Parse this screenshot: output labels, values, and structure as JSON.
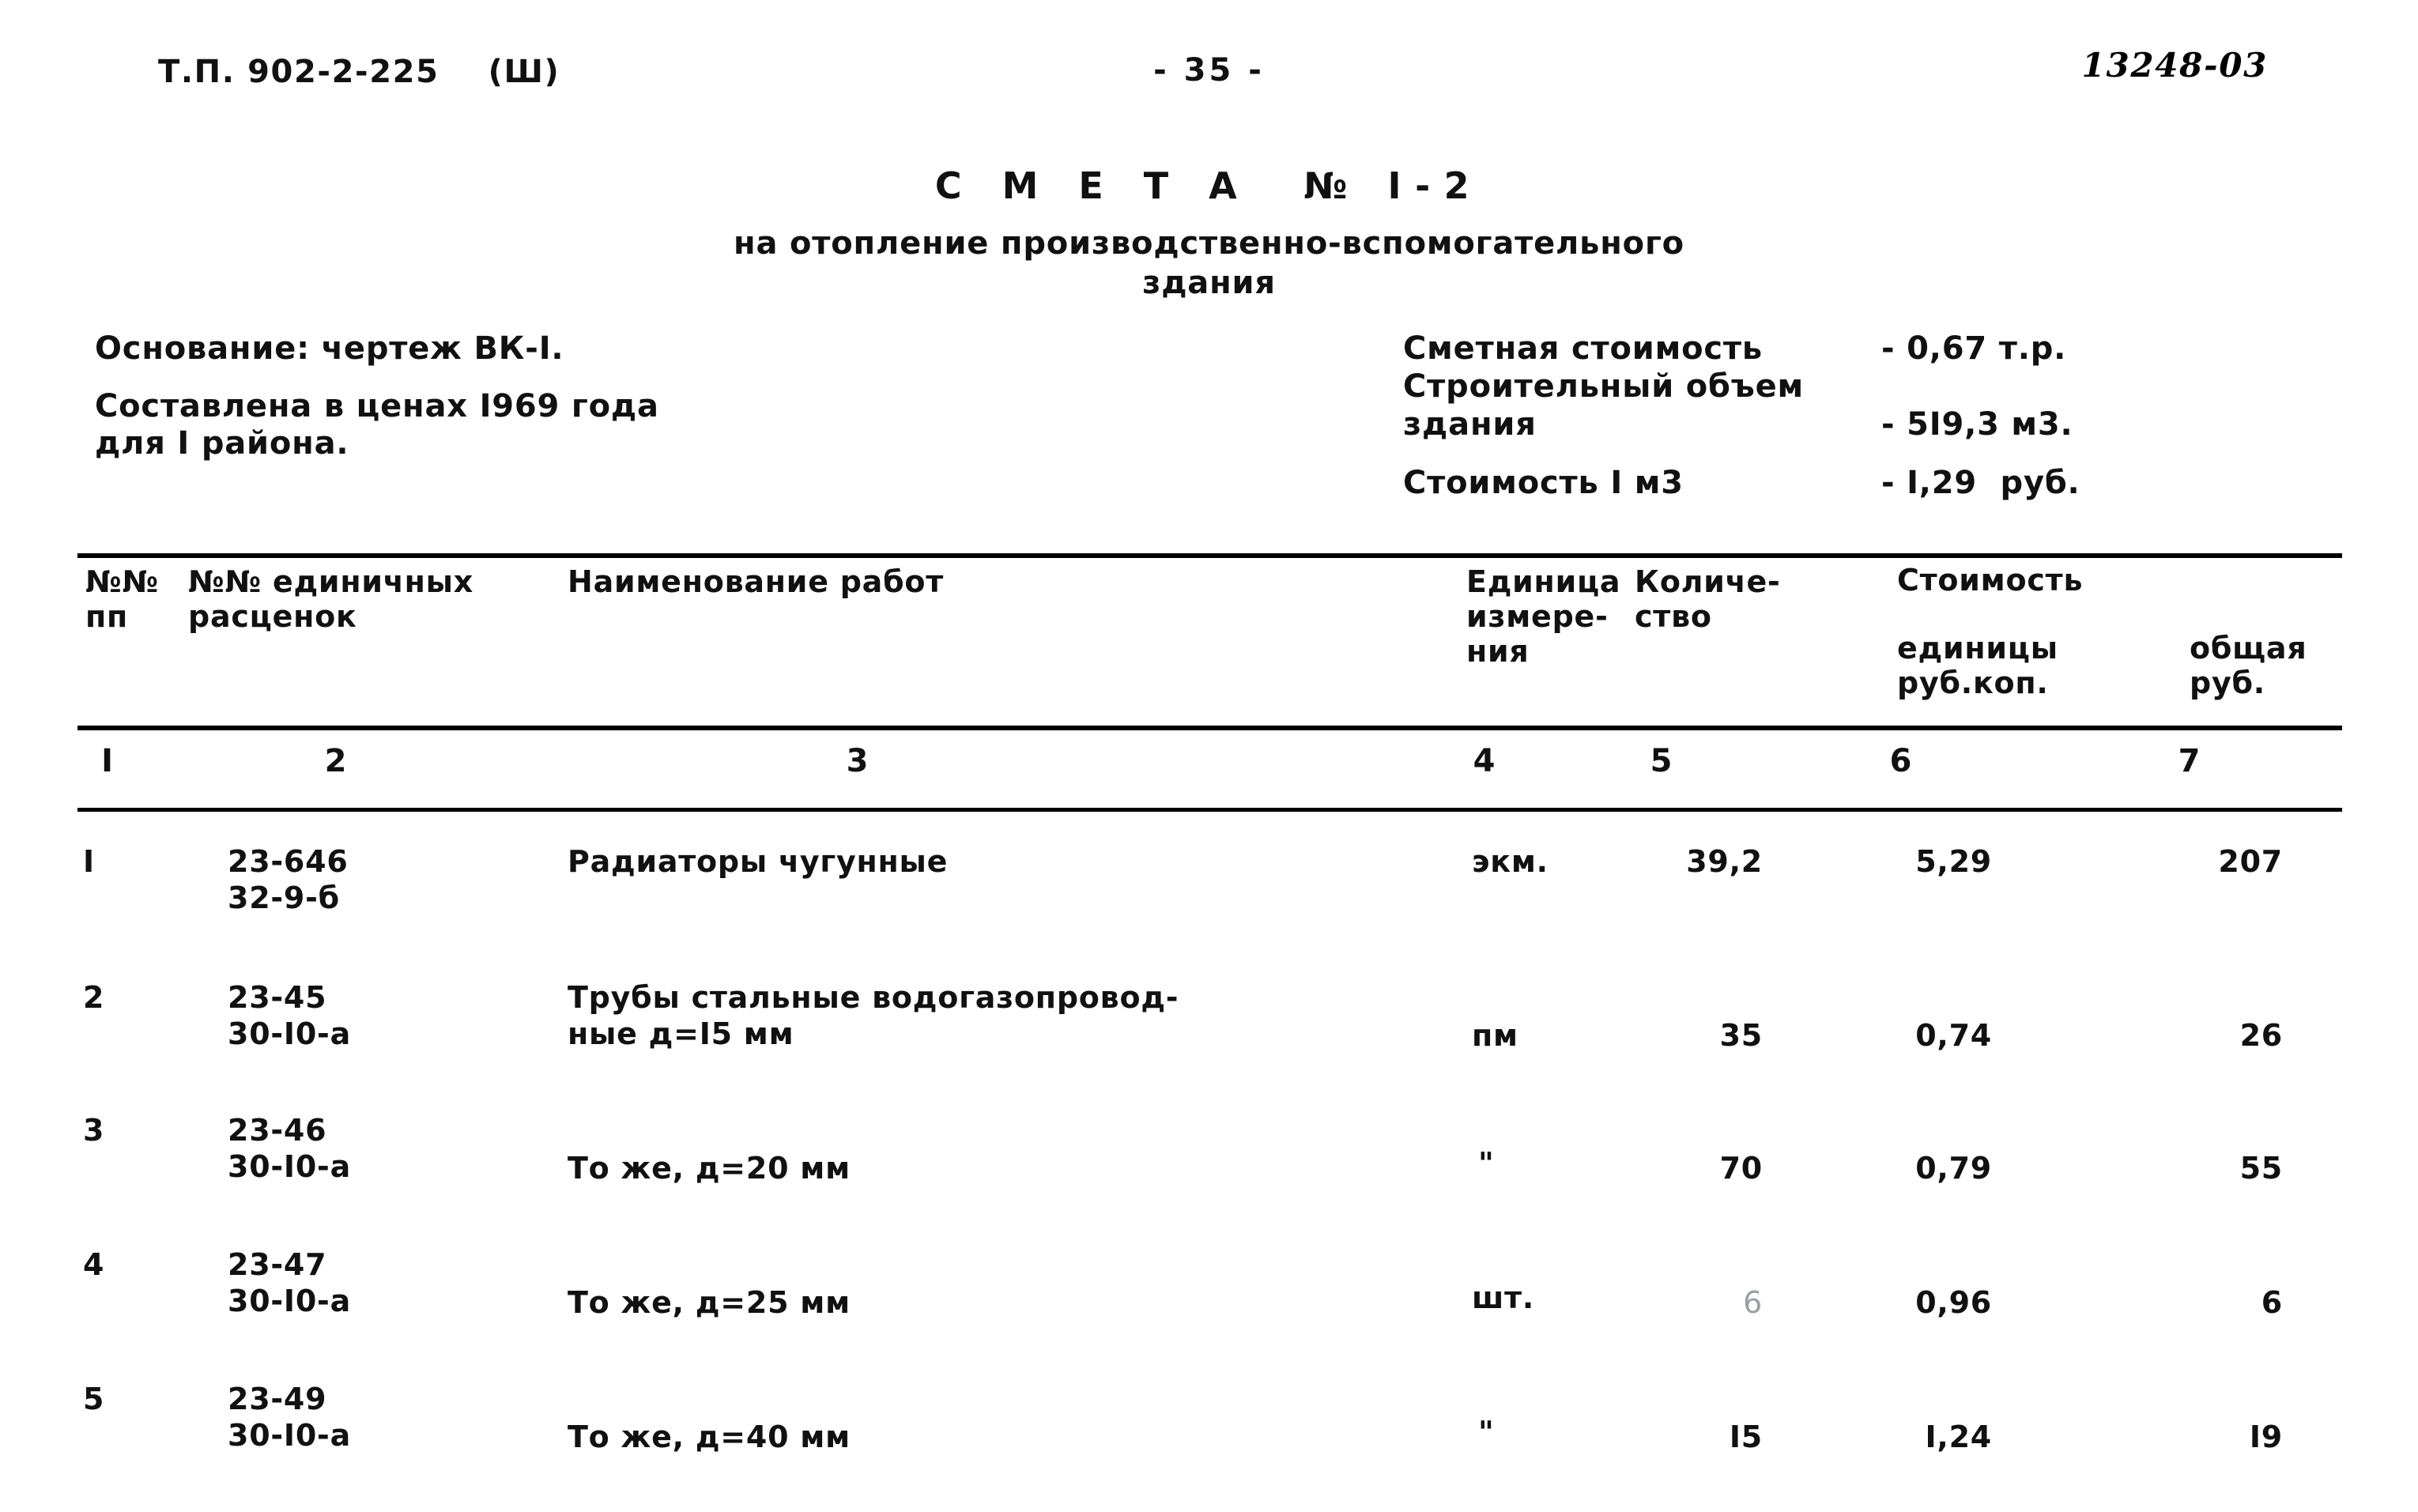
{
  "header": {
    "doc_code": "Т.П. 902-2-225    (Ш)",
    "page_number": "- 35 -",
    "archive_number": "13248-03"
  },
  "title": {
    "main": "С М Е Т А  № I-2",
    "sub_line1": "на отопление производственно-вспомогательного",
    "sub_line2": "здания"
  },
  "meta_left": {
    "basis": "Основание: чертеж ВК-I.",
    "compiled_line1": "Составлена в ценах I969 года",
    "compiled_line2": "для I района."
  },
  "meta_right": {
    "rows": [
      {
        "label": "Сметная стоимость",
        "value": "- 0,67 т.р."
      },
      {
        "label": "Строительный объем",
        "value": ""
      },
      {
        "label": "здания",
        "value": "- 5I9,3 м3."
      },
      {
        "label": "Стоимость I м3",
        "value": "- I,29  руб."
      }
    ]
  },
  "table": {
    "headers": {
      "col1_line1": "№№",
      "col1_line2": "пп",
      "col2_line1": "№№ единичных",
      "col2_line2": "расценок",
      "col3": "Наименование работ",
      "col4_line1": "Единица",
      "col4_line2": "измере-",
      "col4_line3": "ния",
      "col5_line1": "Количе-",
      "col5_line2": "ство",
      "col67_group": "Стоимость",
      "col6_line1": "единицы",
      "col6_line2": "руб.коп.",
      "col7_line1": "общая",
      "col7_line2": "руб."
    },
    "column_numbers": [
      "I",
      "2",
      "3",
      "4",
      "5",
      "6",
      "7"
    ],
    "rows": [
      {
        "num": "I",
        "code_line1": "23-646",
        "code_line2": "32-9-б",
        "name_line1": "Радиаторы чугунные",
        "name_line2": "",
        "unit": "экм.",
        "quantity": "39,2",
        "price_unit": "5,29",
        "total": "207",
        "quantity_faint": false
      },
      {
        "num": "2",
        "code_line1": "23-45",
        "code_line2": "30-I0-а",
        "name_line1": "Трубы стальные водогазопровод-",
        "name_line2": "ные д=I5 мм",
        "unit": "пм",
        "quantity": "35",
        "price_unit": "0,74",
        "total": "26",
        "quantity_faint": false
      },
      {
        "num": "3",
        "code_line1": "23-46",
        "code_line2": "30-I0-а",
        "name_line1": "То же, д=20 мм",
        "name_line2": "",
        "unit": "\"",
        "quantity": "70",
        "price_unit": "0,79",
        "total": "55",
        "quantity_faint": false
      },
      {
        "num": "4",
        "code_line1": "23-47",
        "code_line2": "30-I0-а",
        "name_line1": "То же, д=25 мм",
        "name_line2": "",
        "unit": "шт.",
        "quantity": "6",
        "price_unit": "0,96",
        "total": "6",
        "quantity_faint": true
      },
      {
        "num": "5",
        "code_line1": "23-49",
        "code_line2": "30-I0-а",
        "name_line1": "То же, д=40 мм",
        "name_line2": "",
        "unit": "\"",
        "quantity": "I5",
        "price_unit": "I,24",
        "total": "I9",
        "quantity_faint": false
      }
    ]
  },
  "colors": {
    "ink": "#111111",
    "paper": "#ffffff",
    "faint_ink": "#9aa0a3"
  }
}
